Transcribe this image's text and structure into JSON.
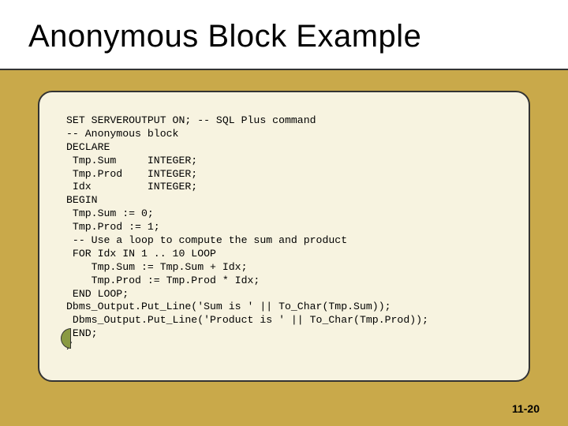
{
  "title": "Anonymous Block Example",
  "code_lines": [
    "SET SERVEROUTPUT ON; -- SQL Plus command",
    "-- Anonymous block",
    "DECLARE",
    " Tmp.Sum     INTEGER;",
    " Tmp.Prod    INTEGER;",
    " Idx         INTEGER;",
    "BEGIN",
    " Tmp.Sum := 0;",
    " Tmp.Prod := 1;",
    " -- Use a loop to compute the sum and product",
    " FOR Idx IN 1 .. 10 LOOP",
    "    Tmp.Sum := Tmp.Sum + Idx;",
    "    Tmp.Prod := Tmp.Prod * Idx;",
    " END LOOP;",
    "Dbms_Output.Put_Line('Sum is ' || To_Char(Tmp.Sum));",
    " Dbms_Output.Put_Line('Product is ' || To_Char(Tmp.Prod));",
    " END;",
    "/"
  ],
  "footer": "11-20",
  "colors": {
    "slide_bg": "#c9a94a",
    "panel_bg": "#f7f3e0",
    "border": "#333333",
    "tab": "#8a9a42"
  }
}
